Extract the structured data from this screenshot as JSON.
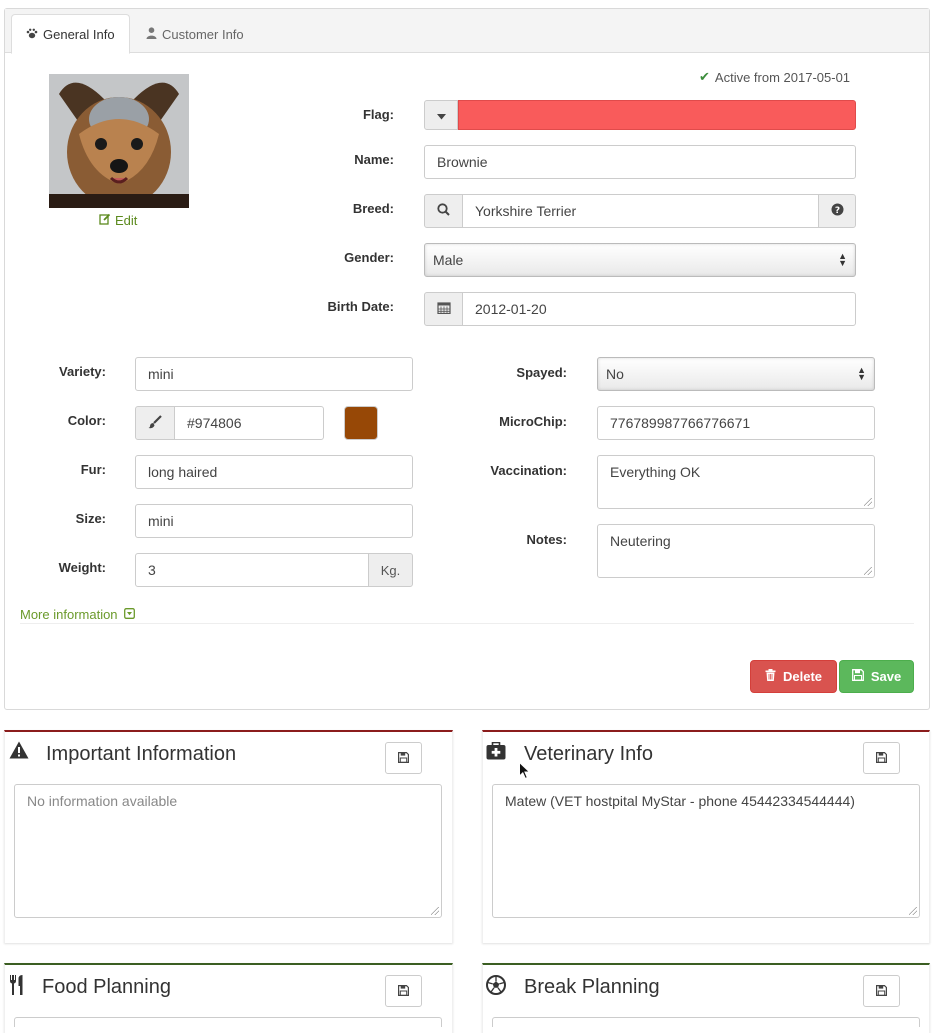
{
  "tabs": [
    {
      "label": "General Info",
      "icon": "paw-icon",
      "active": true
    },
    {
      "label": "Customer Info",
      "icon": "user-icon",
      "active": false
    }
  ],
  "photo": {
    "edit_label": "Edit"
  },
  "status": {
    "active_from": "Active from 2017-05-01"
  },
  "flag": {
    "label": "Flag:",
    "color": "#f95b5b"
  },
  "name": {
    "label": "Name:",
    "value": "Brownie"
  },
  "breed": {
    "label": "Breed:",
    "value": "Yorkshire Terrier"
  },
  "gender": {
    "label": "Gender:",
    "value": "Male"
  },
  "birth_date": {
    "label": "Birth Date:",
    "value": "2012-01-20"
  },
  "variety": {
    "label": "Variety:",
    "value": "mini"
  },
  "color": {
    "label": "Color:",
    "value": "#974806",
    "swatch": "#974806"
  },
  "fur": {
    "label": "Fur:",
    "value": "long haired"
  },
  "size": {
    "label": "Size:",
    "value": "mini"
  },
  "weight": {
    "label": "Weight:",
    "value": "3",
    "unit": "Kg."
  },
  "spayed": {
    "label": "Spayed:",
    "value": "No"
  },
  "microchip": {
    "label": "MicroChip:",
    "value": "776789987766776671"
  },
  "vaccination": {
    "label": "Vaccination:",
    "value": "Everything OK"
  },
  "notes": {
    "label": "Notes:",
    "value": "Neutering"
  },
  "more_information": "More information",
  "actions": {
    "delete": "Delete",
    "save": "Save"
  },
  "boxes": {
    "important": {
      "title": "Important Information",
      "placeholder": "No information available"
    },
    "veterinary": {
      "title": "Veterinary Info",
      "value": "Matew (VET hostpital MyStar - phone 45442334544444)"
    },
    "food": {
      "title": "Food Planning"
    },
    "break": {
      "title": "Break Planning"
    }
  },
  "colors": {
    "primary_green": "#5cb85c",
    "danger": "#d9534f",
    "link": "#5c8a1e",
    "box_red": "#8b1c1c",
    "box_green": "#3b5e22"
  }
}
